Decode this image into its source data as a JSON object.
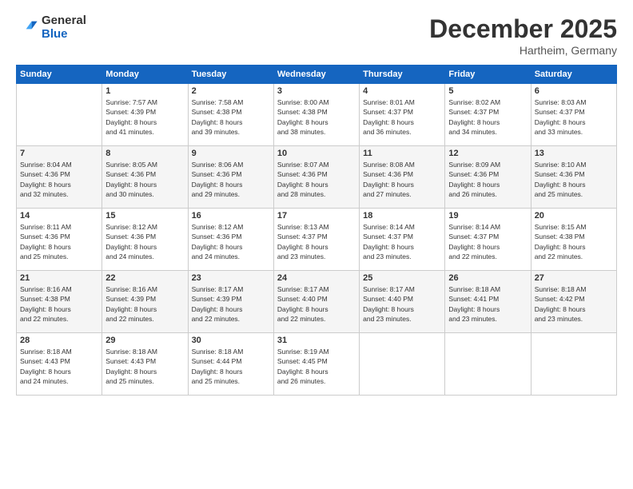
{
  "logo": {
    "general": "General",
    "blue": "Blue"
  },
  "title": "December 2025",
  "location": "Hartheim, Germany",
  "days_header": [
    "Sunday",
    "Monday",
    "Tuesday",
    "Wednesday",
    "Thursday",
    "Friday",
    "Saturday"
  ],
  "weeks": [
    [
      {
        "day": "",
        "info": ""
      },
      {
        "day": "1",
        "info": "Sunrise: 7:57 AM\nSunset: 4:39 PM\nDaylight: 8 hours\nand 41 minutes."
      },
      {
        "day": "2",
        "info": "Sunrise: 7:58 AM\nSunset: 4:38 PM\nDaylight: 8 hours\nand 39 minutes."
      },
      {
        "day": "3",
        "info": "Sunrise: 8:00 AM\nSunset: 4:38 PM\nDaylight: 8 hours\nand 38 minutes."
      },
      {
        "day": "4",
        "info": "Sunrise: 8:01 AM\nSunset: 4:37 PM\nDaylight: 8 hours\nand 36 minutes."
      },
      {
        "day": "5",
        "info": "Sunrise: 8:02 AM\nSunset: 4:37 PM\nDaylight: 8 hours\nand 34 minutes."
      },
      {
        "day": "6",
        "info": "Sunrise: 8:03 AM\nSunset: 4:37 PM\nDaylight: 8 hours\nand 33 minutes."
      }
    ],
    [
      {
        "day": "7",
        "info": "Sunrise: 8:04 AM\nSunset: 4:36 PM\nDaylight: 8 hours\nand 32 minutes."
      },
      {
        "day": "8",
        "info": "Sunrise: 8:05 AM\nSunset: 4:36 PM\nDaylight: 8 hours\nand 30 minutes."
      },
      {
        "day": "9",
        "info": "Sunrise: 8:06 AM\nSunset: 4:36 PM\nDaylight: 8 hours\nand 29 minutes."
      },
      {
        "day": "10",
        "info": "Sunrise: 8:07 AM\nSunset: 4:36 PM\nDaylight: 8 hours\nand 28 minutes."
      },
      {
        "day": "11",
        "info": "Sunrise: 8:08 AM\nSunset: 4:36 PM\nDaylight: 8 hours\nand 27 minutes."
      },
      {
        "day": "12",
        "info": "Sunrise: 8:09 AM\nSunset: 4:36 PM\nDaylight: 8 hours\nand 26 minutes."
      },
      {
        "day": "13",
        "info": "Sunrise: 8:10 AM\nSunset: 4:36 PM\nDaylight: 8 hours\nand 25 minutes."
      }
    ],
    [
      {
        "day": "14",
        "info": "Sunrise: 8:11 AM\nSunset: 4:36 PM\nDaylight: 8 hours\nand 25 minutes."
      },
      {
        "day": "15",
        "info": "Sunrise: 8:12 AM\nSunset: 4:36 PM\nDaylight: 8 hours\nand 24 minutes."
      },
      {
        "day": "16",
        "info": "Sunrise: 8:12 AM\nSunset: 4:36 PM\nDaylight: 8 hours\nand 24 minutes."
      },
      {
        "day": "17",
        "info": "Sunrise: 8:13 AM\nSunset: 4:37 PM\nDaylight: 8 hours\nand 23 minutes."
      },
      {
        "day": "18",
        "info": "Sunrise: 8:14 AM\nSunset: 4:37 PM\nDaylight: 8 hours\nand 23 minutes."
      },
      {
        "day": "19",
        "info": "Sunrise: 8:14 AM\nSunset: 4:37 PM\nDaylight: 8 hours\nand 22 minutes."
      },
      {
        "day": "20",
        "info": "Sunrise: 8:15 AM\nSunset: 4:38 PM\nDaylight: 8 hours\nand 22 minutes."
      }
    ],
    [
      {
        "day": "21",
        "info": "Sunrise: 8:16 AM\nSunset: 4:38 PM\nDaylight: 8 hours\nand 22 minutes."
      },
      {
        "day": "22",
        "info": "Sunrise: 8:16 AM\nSunset: 4:39 PM\nDaylight: 8 hours\nand 22 minutes."
      },
      {
        "day": "23",
        "info": "Sunrise: 8:17 AM\nSunset: 4:39 PM\nDaylight: 8 hours\nand 22 minutes."
      },
      {
        "day": "24",
        "info": "Sunrise: 8:17 AM\nSunset: 4:40 PM\nDaylight: 8 hours\nand 22 minutes."
      },
      {
        "day": "25",
        "info": "Sunrise: 8:17 AM\nSunset: 4:40 PM\nDaylight: 8 hours\nand 23 minutes."
      },
      {
        "day": "26",
        "info": "Sunrise: 8:18 AM\nSunset: 4:41 PM\nDaylight: 8 hours\nand 23 minutes."
      },
      {
        "day": "27",
        "info": "Sunrise: 8:18 AM\nSunset: 4:42 PM\nDaylight: 8 hours\nand 23 minutes."
      }
    ],
    [
      {
        "day": "28",
        "info": "Sunrise: 8:18 AM\nSunset: 4:43 PM\nDaylight: 8 hours\nand 24 minutes."
      },
      {
        "day": "29",
        "info": "Sunrise: 8:18 AM\nSunset: 4:43 PM\nDaylight: 8 hours\nand 25 minutes."
      },
      {
        "day": "30",
        "info": "Sunrise: 8:18 AM\nSunset: 4:44 PM\nDaylight: 8 hours\nand 25 minutes."
      },
      {
        "day": "31",
        "info": "Sunrise: 8:19 AM\nSunset: 4:45 PM\nDaylight: 8 hours\nand 26 minutes."
      },
      {
        "day": "",
        "info": ""
      },
      {
        "day": "",
        "info": ""
      },
      {
        "day": "",
        "info": ""
      }
    ]
  ]
}
